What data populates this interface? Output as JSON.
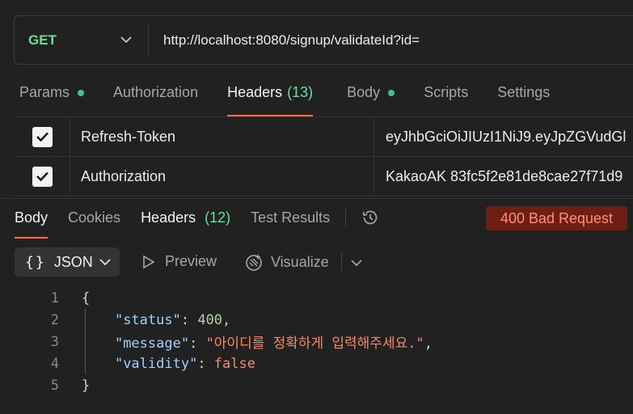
{
  "request": {
    "method": "GET",
    "url": "http://localhost:8080/signup/validateId?id="
  },
  "request_tabs": [
    {
      "label": "Params",
      "count": "",
      "dot": true
    },
    {
      "label": "Authorization",
      "count": "",
      "dot": false
    },
    {
      "label": "Headers",
      "count": "(13)",
      "dot": false
    },
    {
      "label": "Body",
      "count": "",
      "dot": true
    },
    {
      "label": "Scripts",
      "count": "",
      "dot": false
    },
    {
      "label": "Settings",
      "count": "",
      "dot": false
    }
  ],
  "headers": [
    {
      "key": "Refresh-Token",
      "value": "eyJhbGciOiJIUzI1NiJ9.eyJpZGVudGl",
      "checked": true
    },
    {
      "key": "Authorization",
      "value": "KakaoAK 83fc5f2e81de8cae27f71d9",
      "checked": true
    }
  ],
  "response_tabs": {
    "body": "Body",
    "cookies": "Cookies",
    "headers": "Headers",
    "headers_count": "(12)",
    "test_results": "Test Results"
  },
  "status": "400 Bad Request",
  "toolbar": {
    "format": "JSON",
    "braces": "{}",
    "preview": "Preview",
    "visualize": "Visualize"
  },
  "code": {
    "line_numbers": [
      "1",
      "2",
      "3",
      "4",
      "5"
    ],
    "open_brace": "{",
    "close_brace": "}",
    "status_key": "\"status\"",
    "status_value": "400",
    "message_key": "\"message\"",
    "message_value": "\"아이디를 정확하게 입력해주세요.\"",
    "validity_key": "\"validity\"",
    "validity_value": "false"
  },
  "colors": {
    "accent": "#ff6c37",
    "method": "#6bdd9a",
    "status_bg": "#6c1f12",
    "status_fg": "#ff8f7a"
  }
}
